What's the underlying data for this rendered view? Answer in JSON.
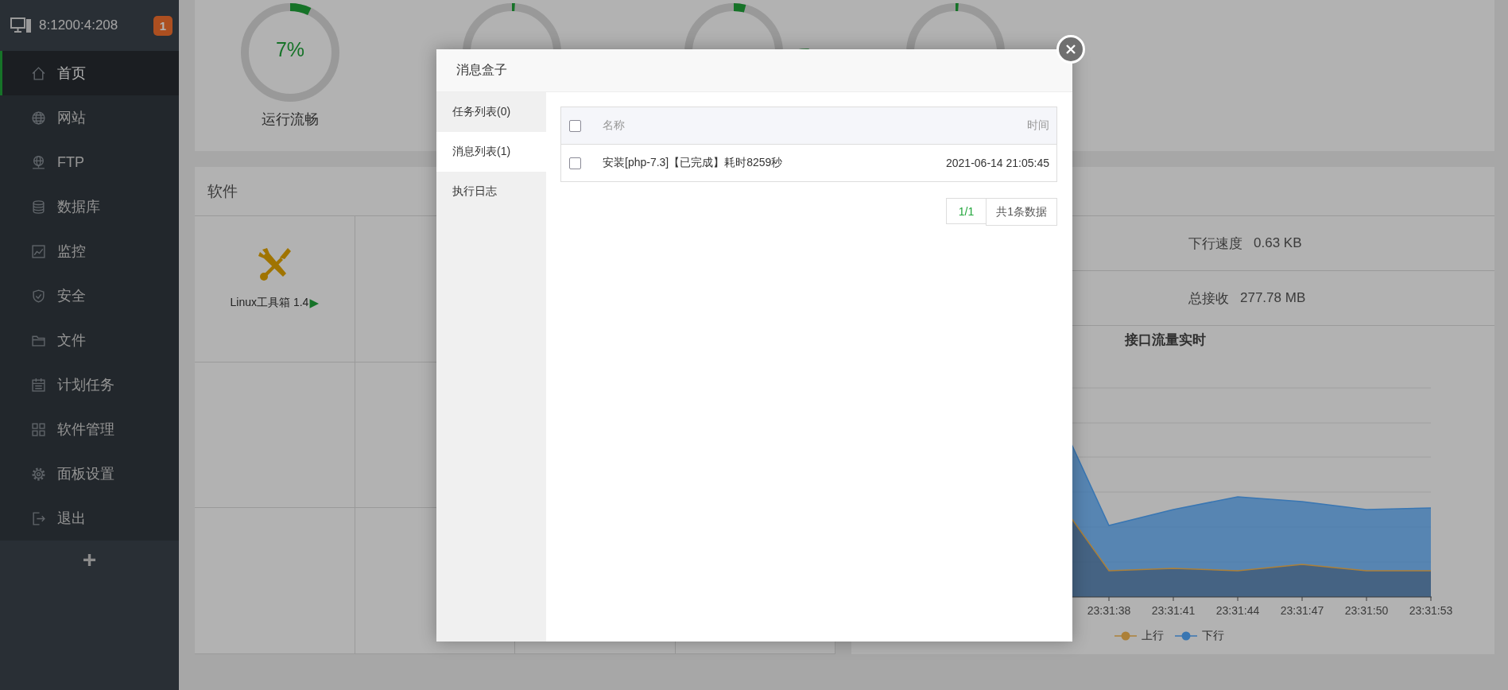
{
  "sidebar": {
    "server": "8:1200:4:208",
    "badge": "1",
    "add_label": "+",
    "items": [
      {
        "label": "首页",
        "selected": true
      },
      {
        "label": "网站",
        "selected": false
      },
      {
        "label": "FTP",
        "selected": false
      },
      {
        "label": "数据库",
        "selected": false
      },
      {
        "label": "监控",
        "selected": false
      },
      {
        "label": "安全",
        "selected": false
      },
      {
        "label": "文件",
        "selected": false
      },
      {
        "label": "计划任务",
        "selected": false
      },
      {
        "label": "软件管理",
        "selected": false
      },
      {
        "label": "面板设置",
        "selected": false
      },
      {
        "label": "退出",
        "selected": false
      }
    ]
  },
  "gauges": [
    {
      "kind": "labeled",
      "value": "7%",
      "label": "运行流畅",
      "level": 0.07
    },
    {
      "kind": "plain",
      "level": 0.01
    },
    {
      "kind": "rocket",
      "level": 0.04
    },
    {
      "kind": "plain",
      "level": 0.01
    }
  ],
  "software": {
    "title": "软件",
    "items": [
      {
        "name": "Linux工具箱 1.4",
        "arrow": "▶"
      }
    ]
  },
  "traffic": {
    "rows": [
      {
        "label": "下行速度",
        "value": "0.63 KB"
      },
      {
        "label": "总接收",
        "value": "277.78 MB"
      }
    ],
    "chart_title": "接口流量实时",
    "x_labels": [
      "23:31:38",
      "23:31:41",
      "23:31:44",
      "23:31:47",
      "23:31:50",
      "23:31:53"
    ],
    "legend": [
      {
        "label": "上行"
      },
      {
        "label": "下行"
      }
    ]
  },
  "modal": {
    "title": "消息盒子",
    "tabs": [
      {
        "label": "任务列表(0)",
        "selected": false
      },
      {
        "label": "消息列表(1)",
        "selected": true
      },
      {
        "label": "执行日志",
        "selected": false
      }
    ],
    "table": {
      "header_checked": false,
      "columns": [
        "名称",
        "时间"
      ],
      "rows": [
        {
          "name": "安装[php-7.3]【已完成】耗时8259秒",
          "time": "2021-06-14 21:05:45",
          "checked": false
        }
      ]
    },
    "pagination": {
      "page": "1/1",
      "total": "共1条数据"
    }
  }
}
